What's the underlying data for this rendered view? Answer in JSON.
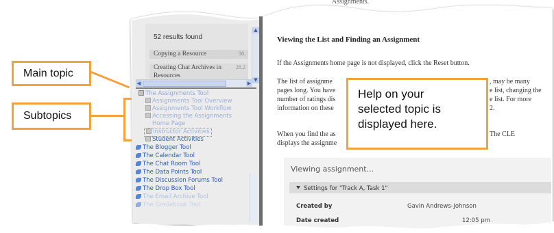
{
  "colors": {
    "callout_border": "#f2a23b",
    "link_blue": "#2a58c0",
    "subtopic_blue": "#9bb0da",
    "panel_gray": "#f2f2f2",
    "pane_divider": "#7a7a7a"
  },
  "search_results": {
    "count_text": "52 results found",
    "rows": [
      {
        "title": "Copying a Resource",
        "score": "38."
      },
      {
        "title": "Creating Chat Archives in Resources",
        "score": "28.2"
      }
    ]
  },
  "tree": {
    "main_topic": "The Assignments Tool",
    "subtopics": [
      "Assignments Tool Overview",
      "Assignments Tool Workflow",
      "Accessing the Assignments",
      "Home Page",
      "Instructor Activities"
    ],
    "student": "Student Activities",
    "tools": [
      "The Blogger Tool",
      "The Calendar Tool",
      "The Chat Room Tool",
      "The Data Points Tool",
      "The Discussion Forums Tool",
      "The Drop Box Tool",
      "The Email Archive Tool",
      "The Gradebook Tool"
    ]
  },
  "document": {
    "top_fragment": "Assignments.",
    "heading": "Viewing the List and Finding an Assignment",
    "para1": "If the Assignments home page is not displayed, click the Reset button.",
    "para2_lines": [
      "The list of assignme",
      "pages long. You have",
      "number of ratings dis",
      "information on these"
    ],
    "para2_right": [
      ", may be many",
      "e list, changing the",
      "e list. For more",
      "2."
    ],
    "para3_lines": [
      "When you find the as",
      "displays the assignme"
    ],
    "para3_right": "The CLE",
    "panel": {
      "title": "Viewing assignment...",
      "bar": "Settings for \"Track A, Task 1\"",
      "rows": [
        {
          "label": "Created by",
          "value": "Gavin Andrews-Johnson"
        },
        {
          "label": "Date created",
          "value": "12:05 pm"
        }
      ]
    }
  },
  "callouts": {
    "main_topic": "Main topic",
    "subtopics": "Subtopics",
    "help_lines": [
      "Help on your",
      "selected topic is",
      "displayed here."
    ]
  }
}
